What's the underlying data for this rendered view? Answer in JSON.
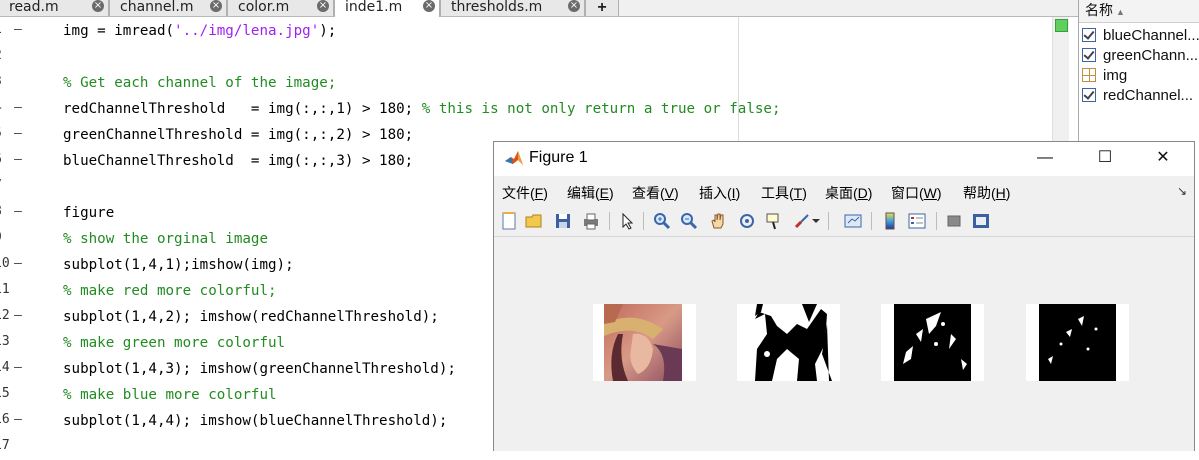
{
  "tabs": [
    {
      "label": "read.m"
    },
    {
      "label": "channel.m"
    },
    {
      "label": "color.m"
    },
    {
      "label": "inde1.m"
    },
    {
      "label": "thresholds.m"
    }
  ],
  "tab_add_label": "+",
  "tab_close_glyph": "×",
  "editor": {
    "lines": [
      {
        "num": "1",
        "dash": "—",
        "code": "img = imread('../img/lena.jpg');"
      },
      {
        "num": "2",
        "dash": "",
        "code": ""
      },
      {
        "num": "3",
        "dash": "",
        "code": "% Get each channel of the image;"
      },
      {
        "num": "4",
        "dash": "—",
        "code": "redChannelThreshold   = img(:,:,1) > 180; % this is not only return a true or false;"
      },
      {
        "num": "5",
        "dash": "—",
        "code": "greenChannelThreshold = img(:,:,2) > 180;"
      },
      {
        "num": "6",
        "dash": "—",
        "code": "blueChannelThreshold  = img(:,:,3) > 180;"
      },
      {
        "num": "7",
        "dash": "",
        "code": ""
      },
      {
        "num": "8",
        "dash": "—",
        "code": "figure"
      },
      {
        "num": "9",
        "dash": "",
        "code": "% show the orginal image"
      },
      {
        "num": "10",
        "dash": "—",
        "code": "subplot(1,4,1);imshow(img);"
      },
      {
        "num": "11",
        "dash": "",
        "code": "% make red more colorful;"
      },
      {
        "num": "12",
        "dash": "—",
        "code": "subplot(1,4,2); imshow(redChannelThreshold);"
      },
      {
        "num": "13",
        "dash": "",
        "code": "% make green more colorful"
      },
      {
        "num": "14",
        "dash": "—",
        "code": "subplot(1,4,3); imshow(greenChannelThreshold);"
      },
      {
        "num": "15",
        "dash": "",
        "code": "% make blue more colorful"
      },
      {
        "num": "16",
        "dash": "—",
        "code": "subplot(1,4,4); imshow(blueChannelThreshold);"
      },
      {
        "num": "17",
        "dash": "",
        "code": ""
      }
    ]
  },
  "workspace": {
    "header": "名称",
    "sort_glyph": "▲",
    "items": [
      {
        "name": "blueChannel...",
        "icon": "logical-check-icon"
      },
      {
        "name": "greenChann...",
        "icon": "logical-check-icon"
      },
      {
        "name": "img",
        "icon": "matrix-grid-icon"
      },
      {
        "name": "redChannel...",
        "icon": "logical-check-icon"
      }
    ]
  },
  "figure": {
    "title": "Figure 1",
    "window_controls": {
      "minimize": "—",
      "maximize": "☐",
      "close": "✕"
    },
    "menu": [
      {
        "label": "文件(",
        "key": "F",
        "end": ")"
      },
      {
        "label": "编辑(",
        "key": "E",
        "end": ")"
      },
      {
        "label": "查看(",
        "key": "V",
        "end": ")"
      },
      {
        "label": "插入(",
        "key": "I",
        "end": ")"
      },
      {
        "label": "工具(",
        "key": "T",
        "end": ")"
      },
      {
        "label": "桌面(",
        "key": "D",
        "end": ")"
      },
      {
        "label": "窗口(",
        "key": "W",
        "end": ")"
      },
      {
        "label": "帮助(",
        "key": "H",
        "end": ")"
      }
    ],
    "dock_glyph": "↘",
    "toolbar_icons": [
      "new-figure-icon",
      "open-file-icon",
      "save-icon",
      "print-icon",
      "select-arrow-icon",
      "zoom-in-icon",
      "zoom-out-icon",
      "pan-hand-icon",
      "rotate-3d-icon",
      "data-cursor-icon",
      "brush-icon",
      "link-plot-icon",
      "colorbar-icon",
      "legend-icon",
      "hide-plot-tools-icon",
      "show-plot-tools-icon"
    ],
    "subplots": [
      {
        "name": "original-image",
        "kind": "color"
      },
      {
        "name": "red-channel-threshold",
        "kind": "binary-dense"
      },
      {
        "name": "green-channel-threshold",
        "kind": "binary-sparse"
      },
      {
        "name": "blue-channel-threshold",
        "kind": "binary-sparser"
      }
    ]
  },
  "colors": {
    "comment": "#228b22",
    "string": "#a020f0",
    "accent": "#3a66a8"
  }
}
